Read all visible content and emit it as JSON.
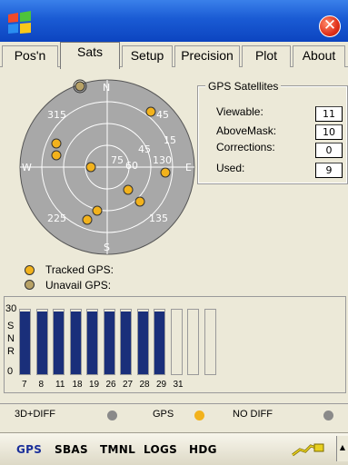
{
  "tabs": [
    {
      "label": "Pos'n"
    },
    {
      "label": "Sats"
    },
    {
      "label": "Setup"
    },
    {
      "label": "Precision"
    },
    {
      "label": "Plot"
    },
    {
      "label": "About"
    }
  ],
  "polar": {
    "compass": {
      "n": "N",
      "s": "S",
      "w": "W",
      "e": "E"
    },
    "ring_labels": [
      "315",
      "45",
      "15",
      "45",
      "75",
      "60",
      "130",
      "225",
      "135"
    ],
    "satellites_tracked_count": 10
  },
  "gps_satellites": {
    "title": "GPS Satellites",
    "rows": [
      {
        "label": "Viewable:",
        "value": "11"
      },
      {
        "label": "AboveMask:",
        "value": "10"
      },
      {
        "label": "Corrections:",
        "value": "0"
      },
      {
        "label": "Used:",
        "value": "9"
      }
    ]
  },
  "legend": {
    "tracked": "Tracked GPS:",
    "unavail": "Unavail GPS:"
  },
  "snr": {
    "max_label": "30",
    "axis_letters": [
      "S",
      "N",
      "R"
    ],
    "zero_label": "0",
    "bars": [
      {
        "id": "7",
        "level": 0.97
      },
      {
        "id": "8",
        "level": 0.97
      },
      {
        "id": "11",
        "level": 0.97
      },
      {
        "id": "18",
        "level": 0.97
      },
      {
        "id": "19",
        "level": 0.97
      },
      {
        "id": "26",
        "level": 0.97
      },
      {
        "id": "27",
        "level": 0.97
      },
      {
        "id": "28",
        "level": 0.97
      },
      {
        "id": "29",
        "level": 0.97
      },
      {
        "id": "31",
        "level": 0
      },
      {
        "id": "",
        "level": 0
      },
      {
        "id": "",
        "level": 0
      }
    ]
  },
  "status": {
    "diff_mode": "3D+DIFF",
    "gps": "GPS",
    "nodiff": "NO DIFF"
  },
  "bottom_menu": [
    "GPS",
    "SBAS",
    "TMNL",
    "LOGS",
    "HDG"
  ],
  "colors": {
    "tracked": "#f2b21c",
    "unavail": "#b8a266",
    "bar": "#1a2f7a",
    "menu_active": "#1a2f9a"
  }
}
